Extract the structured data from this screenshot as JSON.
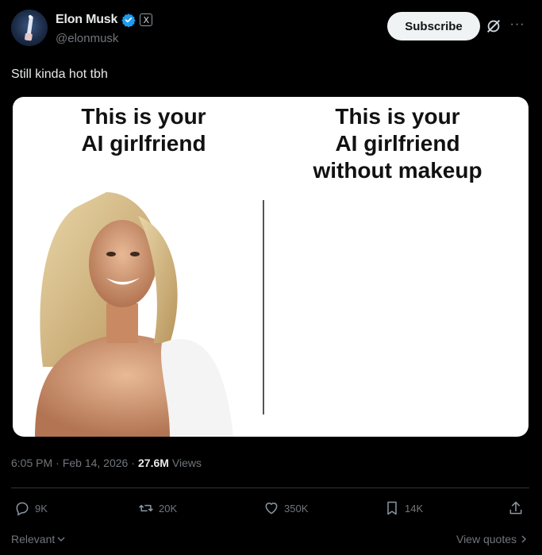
{
  "author": {
    "name": "Elon Musk",
    "handle": "@elonmusk",
    "badge": "X"
  },
  "header": {
    "subscribe_label": "Subscribe",
    "more_label": "···"
  },
  "tweet": {
    "text": "Still kinda hot tbh"
  },
  "media": {
    "left_caption_line1": "This is your",
    "left_caption_line2": "AI girlfriend",
    "right_caption_line1": "This is your",
    "right_caption_line2": "AI girlfriend",
    "right_caption_line3": "without makeup"
  },
  "meta": {
    "time": "6:05 PM",
    "date": "Feb 14, 2026",
    "views_count": "27.6M",
    "views_label": "Views",
    "dot": "·"
  },
  "actions": {
    "replies": "9K",
    "reposts": "20K",
    "likes": "350K",
    "bookmarks": "14K"
  },
  "footer": {
    "sort_label": "Relevant",
    "quotes_label": "View quotes"
  },
  "colors": {
    "background": "#000000",
    "text": "#e7e9ea",
    "muted": "#71767b",
    "verified": "#1d9bf0"
  }
}
